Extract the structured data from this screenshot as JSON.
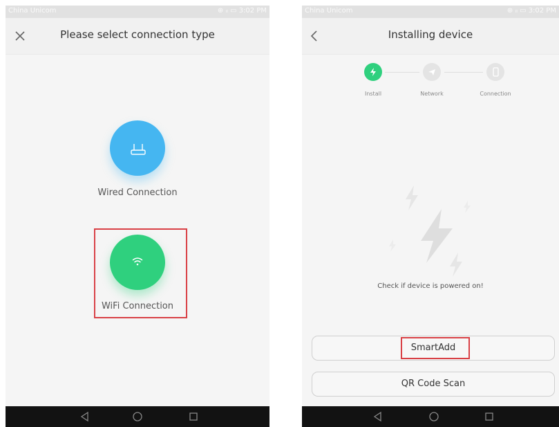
{
  "left_screen": {
    "status_carrier": "China Unicom",
    "status_right": "⊕ ᵢₗ ▭ 3:02 PM",
    "close_icon": "close-icon",
    "title": "Please select connection type",
    "options": [
      {
        "label": "Wired Connection",
        "icon": "router-icon",
        "color": "#45b6f1"
      },
      {
        "label": "WiFi Connection",
        "icon": "wifi-icon",
        "color": "#2fd07e"
      }
    ],
    "highlight_color": "#d94045"
  },
  "right_screen": {
    "status_carrier": "China Unicom",
    "status_right": "⊕ ᵢₗ ▭ 3:02 PM",
    "back_icon": "chevron-left-icon",
    "title": "Installing device",
    "steps": [
      {
        "label": "Install",
        "icon": "lightning-icon",
        "active": true
      },
      {
        "label": "Network",
        "icon": "send-icon",
        "active": false
      },
      {
        "label": "Connection",
        "icon": "phone-icon",
        "active": false
      }
    ],
    "hint": "Check if device is powered on!",
    "buttons": {
      "smart_add": "SmartAdd",
      "qr_scan": "QR Code Scan"
    }
  },
  "bottom_nav": {
    "back": "back-triangle-icon",
    "home": "home-circle-icon",
    "recent": "recent-square-icon"
  }
}
